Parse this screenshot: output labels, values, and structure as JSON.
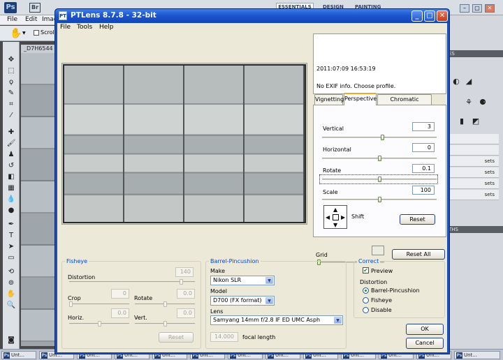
{
  "photoshop": {
    "logo": "Ps",
    "bridge": "Br",
    "menu": [
      "File",
      "Edit",
      "Imag"
    ],
    "scroll_label": "Scroll",
    "doc_tab": "_D7H6544",
    "workspace_tabs": [
      "ESSENTIALS",
      "DESIGN",
      "PAINTING"
    ],
    "panel_tabs_right": [
      "ES",
      "THS"
    ],
    "taskbar_items": [
      "Unt...",
      "Unt...",
      "Unt...",
      "Unt...",
      "Unt...",
      "Unt...",
      "Unt...",
      "Unt...",
      "Unt...",
      "Unt...",
      "Unt...",
      "Unt...",
      "Unt..."
    ],
    "panel_rows": [
      "sets",
      "sets",
      "sets",
      "sets"
    ]
  },
  "window": {
    "title": "PTLens 8.7.8 - 32-bit",
    "menu": [
      "File",
      "Tools",
      "Help"
    ]
  },
  "exif": {
    "datetime": "2011:07:09 16:53:19",
    "message": "No EXIF info. Choose profile."
  },
  "tabs": [
    "Vignetting",
    "Perspective",
    "Chromatic Aberration"
  ],
  "perspective": {
    "vertical_label": "Vertical",
    "vertical_value": "3",
    "horizontal_label": "Horizontal",
    "horizontal_value": "0",
    "rotate_label": "Rotate",
    "rotate_value": "0.1",
    "scale_label": "Scale",
    "scale_value": "100",
    "shift_label": "Shift",
    "reset_label": "Reset"
  },
  "grid_label": "Grid",
  "reset_all_label": "Reset All",
  "fisheye": {
    "title": "Fisheye",
    "distortion_label": "Distortion",
    "distortion_value": "140",
    "crop_label": "Crop",
    "crop_value": "0",
    "rotate_label": "Rotate",
    "rotate_value": "0.0",
    "horiz_label": "Horiz.",
    "horiz_value": "0.0",
    "vert_label": "Vert.",
    "vert_value": "0.0",
    "reset_label": "Reset"
  },
  "barrel": {
    "title": "Barrel-Pincushion",
    "make_label": "Make",
    "make_value": "Nikon SLR",
    "model_label": "Model",
    "model_value": "D700 (FX format)",
    "lens_label": "Lens",
    "lens_value": "Samyang 14mm f/2.8 IF ED UMC Asph",
    "focal_value": "14.000",
    "focal_label": "focal length"
  },
  "correct": {
    "title": "Correct",
    "preview_label": "Preview",
    "distortion_label": "Distortion",
    "options": [
      "Barrel-Pincushion",
      "Fisheye",
      "Disable"
    ]
  },
  "ok_label": "OK",
  "cancel_label": "Cancel",
  "sliders": {
    "vertical": 0.53,
    "horizontal": 0.5,
    "rotate": 0.5,
    "scale": 0.5,
    "grid": 0.0,
    "fisheye_distortion": 0.9,
    "fisheye_crop": 0.0,
    "fisheye_rotate": 0.5,
    "fisheye_horiz": 0.5,
    "fisheye_vert": 0.5
  }
}
